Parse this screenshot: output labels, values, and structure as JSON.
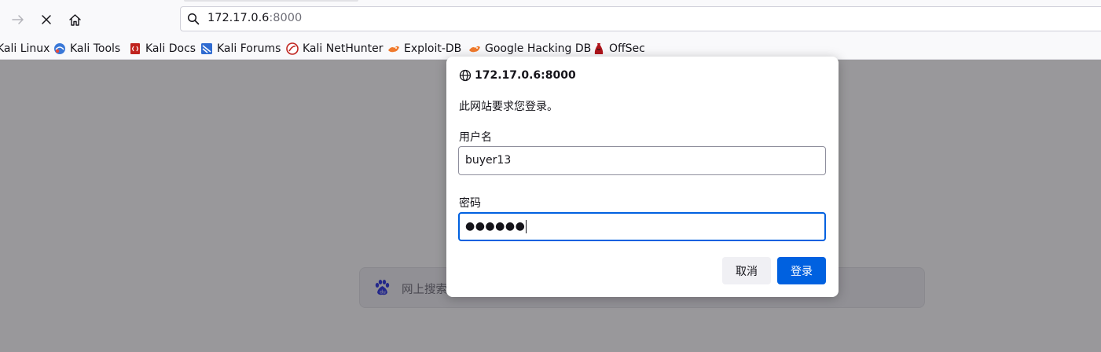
{
  "browser": {
    "url": {
      "host": "172.17.0.6",
      "port": ":8000"
    },
    "bookmarks": [
      {
        "label": "Kali Linux",
        "icon": "kali-linux-icon"
      },
      {
        "label": "Kali Tools",
        "icon": "kali-tools-icon"
      },
      {
        "label": "Kali Docs",
        "icon": "kali-docs-icon"
      },
      {
        "label": "Kali Forums",
        "icon": "kali-forums-icon"
      },
      {
        "label": "Kali NetHunter",
        "icon": "kali-nethunter-icon"
      },
      {
        "label": "Exploit-DB",
        "icon": "exploit-db-icon"
      },
      {
        "label": "Google Hacking DB",
        "icon": "ghdb-icon"
      },
      {
        "label": "OffSec",
        "icon": "offsec-icon"
      }
    ]
  },
  "page": {
    "search_placeholder": "网上搜索"
  },
  "auth_dialog": {
    "origin": "172.17.0.6:8000",
    "message": "此网站要求您登录。",
    "username_label": "用户名",
    "username_value": "buyer13",
    "password_label": "密码",
    "password_mask": "●●●●●●",
    "cancel_label": "取消",
    "login_label": "登录"
  },
  "colors": {
    "accent": "#0061e0",
    "overlay": "#1c1b22",
    "toolbar": "#f9f9fb"
  }
}
